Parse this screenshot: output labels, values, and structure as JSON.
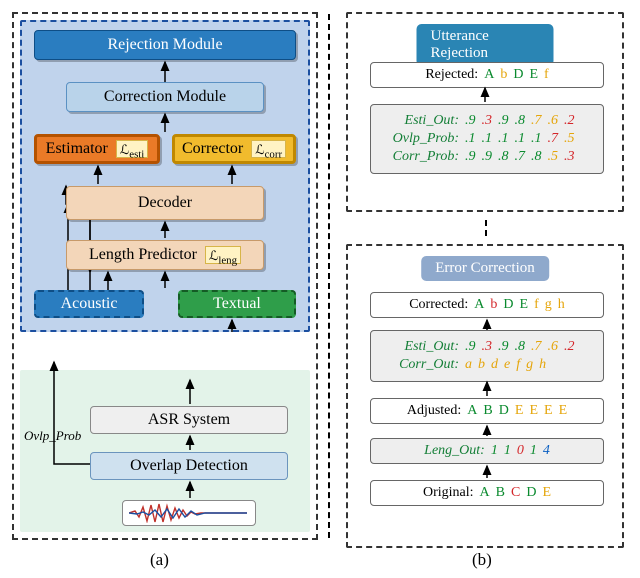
{
  "panelA": {
    "caption": "(a)",
    "rejection": "Rejection Module",
    "correction": "Correction Module",
    "estimator": {
      "label": "Estimator",
      "loss": "ℒ",
      "sub": "esti"
    },
    "corrector": {
      "label": "Corrector",
      "loss": "ℒ",
      "sub": "corr"
    },
    "decoder": "Decoder",
    "lengthPredictor": {
      "label": "Length Predictor",
      "loss": "ℒ",
      "sub": "leng"
    },
    "acoustic": "Acoustic",
    "textual": "Textual",
    "asr": "ASR System",
    "overlap": "Overlap Detection",
    "ovlpProbLabel": "Ovlp_Prob"
  },
  "panelB": {
    "caption": "(b)",
    "utteranceRejection": {
      "title": "Utterance Rejection",
      "rejectedLabel": "Rejected:",
      "rejected": [
        {
          "t": "A",
          "c": "g"
        },
        {
          "t": "b",
          "c": "y"
        },
        {
          "t": "D",
          "c": "g"
        },
        {
          "t": "E",
          "c": "g"
        },
        {
          "t": "f",
          "c": "y"
        }
      ],
      "esti": {
        "label": "Esti_Out:",
        "vals": [
          {
            "t": ".9",
            "c": "g"
          },
          {
            "t": ".3",
            "c": "r"
          },
          {
            "t": ".9",
            "c": "g"
          },
          {
            "t": ".8",
            "c": "g"
          },
          {
            "t": ".7",
            "c": "y"
          },
          {
            "t": ".6",
            "c": "y"
          },
          {
            "t": ".2",
            "c": "r"
          }
        ]
      },
      "ovlp": {
        "label": "Ovlp_Prob:",
        "vals": [
          {
            "t": ".1",
            "c": "g"
          },
          {
            "t": ".1",
            "c": "g"
          },
          {
            "t": ".1",
            "c": "g"
          },
          {
            "t": ".1",
            "c": "g"
          },
          {
            "t": ".1",
            "c": "g"
          },
          {
            "t": ".7",
            "c": "r"
          },
          {
            "t": ".5",
            "c": "y"
          }
        ]
      },
      "corrp": {
        "label": "Corr_Prob:",
        "vals": [
          {
            "t": ".9",
            "c": "g"
          },
          {
            "t": ".9",
            "c": "g"
          },
          {
            "t": ".8",
            "c": "g"
          },
          {
            "t": ".7",
            "c": "g"
          },
          {
            "t": ".8",
            "c": "g"
          },
          {
            "t": ".5",
            "c": "y"
          },
          {
            "t": ".3",
            "c": "r"
          }
        ]
      }
    },
    "errorCorrection": {
      "title": "Error Correction",
      "correctedLabel": "Corrected:",
      "corrected": [
        {
          "t": "A",
          "c": "g"
        },
        {
          "t": "b",
          "c": "r"
        },
        {
          "t": "D",
          "c": "g"
        },
        {
          "t": "E",
          "c": "g"
        },
        {
          "t": "f",
          "c": "y"
        },
        {
          "t": "g",
          "c": "y"
        },
        {
          "t": "h",
          "c": "y"
        }
      ],
      "esti": {
        "label": "Esti_Out:",
        "vals": [
          {
            "t": ".9",
            "c": "g"
          },
          {
            "t": ".3",
            "c": "r"
          },
          {
            "t": ".9",
            "c": "g"
          },
          {
            "t": ".8",
            "c": "g"
          },
          {
            "t": ".7",
            "c": "y"
          },
          {
            "t": ".6",
            "c": "y"
          },
          {
            "t": ".2",
            "c": "r"
          }
        ]
      },
      "corrOut": {
        "label": "Corr_Out:",
        "vals": [
          {
            "t": "a",
            "c": "y"
          },
          {
            "t": "b",
            "c": "y"
          },
          {
            "t": "d",
            "c": "y"
          },
          {
            "t": "e",
            "c": "y"
          },
          {
            "t": "f",
            "c": "y"
          },
          {
            "t": "g",
            "c": "y"
          },
          {
            "t": "h",
            "c": "y"
          }
        ]
      },
      "adjustedLabel": "Adjusted:",
      "adjusted": [
        {
          "t": "A",
          "c": "g"
        },
        {
          "t": "B",
          "c": "g"
        },
        {
          "t": "D",
          "c": "g"
        },
        {
          "t": "E",
          "c": "y"
        },
        {
          "t": "E",
          "c": "y"
        },
        {
          "t": "E",
          "c": "y"
        },
        {
          "t": "E",
          "c": "y"
        }
      ],
      "leng": {
        "label": "Leng_Out:",
        "vals": [
          {
            "t": "1",
            "c": "g"
          },
          {
            "t": "1",
            "c": "g"
          },
          {
            "t": "0",
            "c": "r"
          },
          {
            "t": "1",
            "c": "g"
          },
          {
            "t": "4",
            "c": "b"
          }
        ]
      },
      "originalLabel": "Original:",
      "original": [
        {
          "t": "A",
          "c": "g"
        },
        {
          "t": "B",
          "c": "g"
        },
        {
          "t": "C",
          "c": "r"
        },
        {
          "t": "D",
          "c": "g"
        },
        {
          "t": "E",
          "c": "y"
        }
      ]
    }
  }
}
